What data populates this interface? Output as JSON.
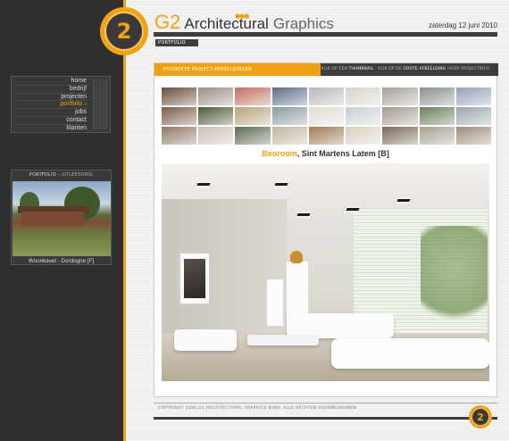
{
  "brand": {
    "logo_text": "2",
    "g2": "G2",
    "architectural": "Architectural",
    "graphics": "Graphics",
    "accent_color": "#f0a214"
  },
  "header": {
    "date": "zaterdag 12 juni 2010",
    "breadcrumb": "PORTFOLIO"
  },
  "nav": {
    "items": [
      {
        "label": "home",
        "active": false
      },
      {
        "label": "bedrijf",
        "active": false
      },
      {
        "label": "projecten",
        "active": false
      },
      {
        "label": "portfolio",
        "active": true
      },
      {
        "label": "jobs",
        "active": false
      },
      {
        "label": "contact",
        "active": false
      },
      {
        "label": "klanten",
        "active": false
      }
    ],
    "active_marker": "»"
  },
  "preview": {
    "title_main": "PORTFOLIO",
    "title_sep": " - ",
    "title_sub": "UITLEESDING",
    "caption": "Woonkavel - Dordogne [F]"
  },
  "main": {
    "tab_active": "FAVORIETE PROJECT-AFBEELDINGEN",
    "tab_hint_1": "KLIK OP EEN ",
    "tab_hint_bold_1": "THUMBNAIL",
    "tab_hint_2": " - KLIK OP DE ",
    "tab_hint_bold_2": "GROTE AFBEELDING",
    "tab_hint_3": " VOOR PROJECTINFO",
    "project_name": "Beoroom",
    "project_location": ", Sint Martens Latem [B]"
  },
  "thumbnails": {
    "colors": [
      "#6d4b3a",
      "#9a8f84",
      "#c07060",
      "#5b6f86",
      "#b8b8b8",
      "#d8d2c8",
      "#a7a19a",
      "#8a8f8a",
      "#94a1b4",
      "#7d5c4a",
      "#4e5a3a",
      "#b9a37a",
      "#8c9aa0",
      "#e0dcd4",
      "#c8cfd2",
      "#a49a8e",
      "#6b7d5e",
      "#9aa6ad",
      "#8e7a66",
      "#c9bfb3",
      "#5f6c55",
      "#c0b4a0",
      "#a07a52",
      "#d9cfc1",
      "#7a6a5b",
      "#a8a091",
      "#9b8f7d"
    ]
  },
  "footer": {
    "copyright": "COPYRIGHT 2006 G2 ARCHITECTURAL GRAPHICS BVBA. ALLE RECHTEN VOORBEHOUDEN",
    "logo_text": "2"
  }
}
